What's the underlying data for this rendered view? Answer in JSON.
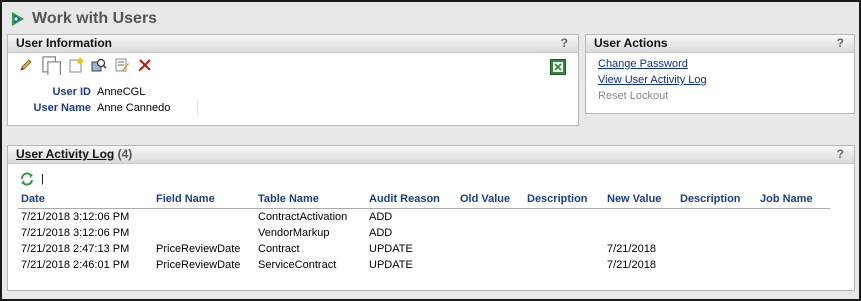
{
  "page": {
    "title": "Work with Users"
  },
  "user_info": {
    "header": "User Information",
    "help": "?",
    "user_id_label": "User ID",
    "user_id_value": "AnneCGL",
    "user_name_label": "User Name",
    "user_name_value": "Anne Cannedo",
    "toolbar_icons": [
      "edit-icon",
      "copy-icon",
      "new-icon",
      "find-icon",
      "notes-icon",
      "delete-icon",
      "excel-export-icon"
    ]
  },
  "user_actions": {
    "header": "User Actions",
    "help": "?",
    "links": [
      "Change Password",
      "View User Activity Log"
    ],
    "disabled": "Reset Lockout"
  },
  "activity_log": {
    "header": "User Activity Log",
    "count": "(4)",
    "help": "?",
    "toolbar_sep": "|",
    "columns": [
      "Date",
      "Field Name",
      "Table Name",
      "Audit Reason",
      "Old Value",
      "Description",
      "New Value",
      "Description",
      "Job Name"
    ],
    "rows": [
      [
        "7/21/2018 3:12:06 PM",
        "",
        "ContractActivation",
        "ADD",
        "",
        "",
        "",
        "",
        ""
      ],
      [
        "7/21/2018 3:12:06 PM",
        "",
        "VendorMarkup",
        "ADD",
        "",
        "",
        "",
        "",
        ""
      ],
      [
        "7/21/2018 2:47:13 PM",
        "PriceReviewDate",
        "Contract",
        "UPDATE",
        "",
        "",
        "7/21/2018",
        "",
        ""
      ],
      [
        "7/21/2018 2:46:01 PM",
        "PriceReviewDate",
        "ServiceContract",
        "UPDATE",
        "",
        "",
        "7/21/2018",
        "",
        ""
      ]
    ]
  },
  "colors": {
    "label_blue": "#1a3d8a",
    "link_blue": "#0a2f9e",
    "disabled_gray": "#888888"
  }
}
